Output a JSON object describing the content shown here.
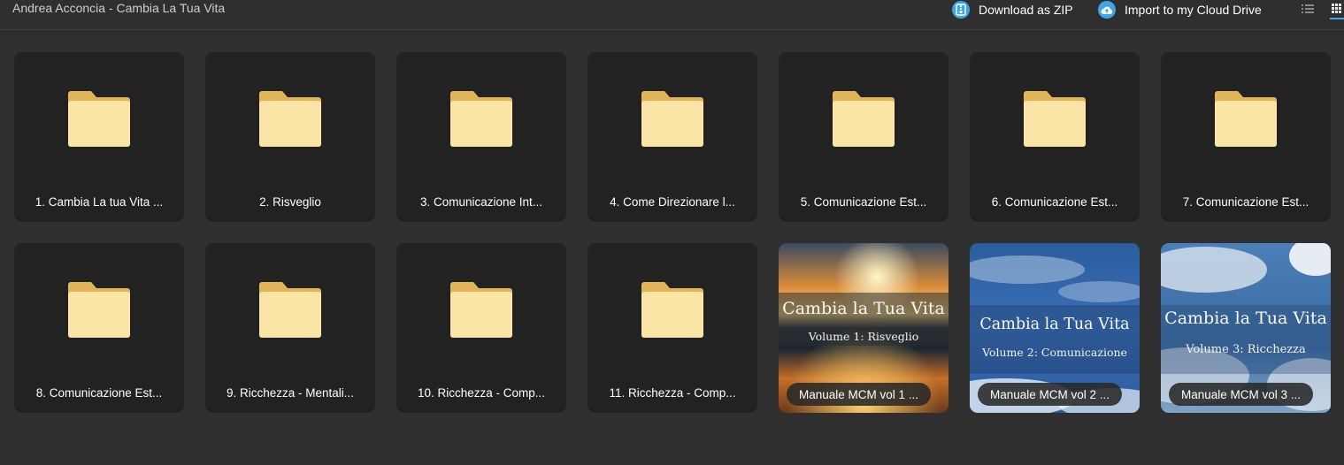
{
  "header": {
    "title": "Andrea Acconcia - Cambia La Tua Vita",
    "download_label": "Download as ZIP",
    "import_label": "Import to my Cloud Drive",
    "download_icon": "zip-archive-icon",
    "import_icon": "cloud-upload-icon",
    "accent_color": "#3fa6e6"
  },
  "folders": [
    {
      "label": "1. Cambia La tua Vita ..."
    },
    {
      "label": "2. Risveglio"
    },
    {
      "label": "3. Comunicazione Int..."
    },
    {
      "label": "4. Come Direzionare l..."
    },
    {
      "label": "5. Comunicazione Est..."
    },
    {
      "label": "6. Comunicazione Est..."
    },
    {
      "label": "7. Comunicazione Est..."
    },
    {
      "label": "8. Comunicazione Est..."
    },
    {
      "label": "9. Ricchezza - Mentali..."
    },
    {
      "label": "10. Ricchezza - Comp..."
    },
    {
      "label": "11. Ricchezza - Comp..."
    }
  ],
  "files": [
    {
      "label": "Manuale MCM vol 1 ...",
      "cover_title": "Cambia la Tua Vita",
      "cover_subtitle": "Volume 1: Risveglio"
    },
    {
      "label": "Manuale MCM vol 2 ...",
      "cover_title": "Cambia la Tua Vita",
      "cover_subtitle": "Volume 2: Comunicazione"
    },
    {
      "label": "Manuale MCM vol 3 ...",
      "cover_title": "Cambia la Tua Vita",
      "cover_subtitle": "Volume 3: Ricchezza"
    }
  ]
}
